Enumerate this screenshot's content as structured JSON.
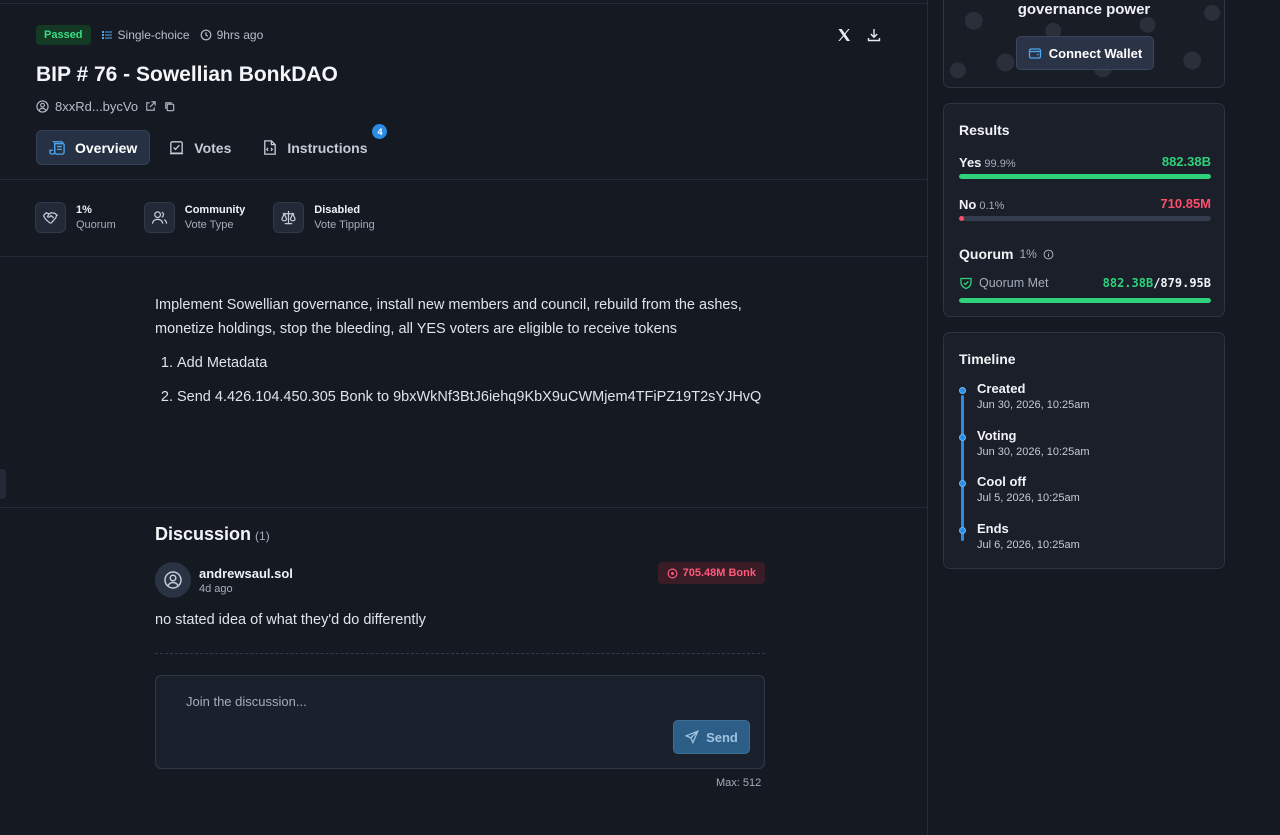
{
  "proposal": {
    "status": "Passed",
    "vote_mode": "Single-choice",
    "age": "9hrs ago",
    "title": "BIP # 76 - Sowellian BonkDAO",
    "author_address": "8xxRd...bycVo"
  },
  "tabs": [
    {
      "label": "Overview",
      "active": true
    },
    {
      "label": "Votes",
      "active": false
    },
    {
      "label": "Instructions",
      "active": false,
      "count": "4"
    }
  ],
  "stats": [
    {
      "value": "1%",
      "label": "Quorum",
      "icon": "handshake-icon"
    },
    {
      "value": "Community",
      "label": "Vote Type",
      "icon": "users-icon"
    },
    {
      "value": "Disabled",
      "label": "Vote Tipping",
      "icon": "scale-icon"
    }
  ],
  "description": {
    "text": "Implement Sowellian governance, install new members and council, rebuild from the ashes, monetize holdings, stop the bleeding, all YES voters are eligible to receive tokens",
    "steps": [
      "Add Metadata",
      "Send 4.426.104.450.305 Bonk to 9bxWkNf3BtJ6iehq9KbX9uCWMjem4TFiPZ19T2sYJHvQ"
    ]
  },
  "discussion": {
    "title": "Discussion",
    "count": "(1)",
    "comments": [
      {
        "author": "andrewsaul.sol",
        "time": "4d ago",
        "vote_badge": "705.48M Bonk",
        "body": "no stated idea of what they'd do differently"
      }
    ],
    "composer_placeholder": "Join the discussion...",
    "send_label": "Send",
    "max_label": "Max: 512"
  },
  "governance": {
    "title": "governance power",
    "connect_label": "Connect Wallet"
  },
  "results": {
    "title": "Results",
    "yes": {
      "label": "Yes",
      "pct": "99.9%",
      "value": "882.38B",
      "fraction": 0.999
    },
    "no": {
      "label": "No",
      "pct": "0.1%",
      "value": "710.85M",
      "fraction": 0.001
    },
    "quorum_label": "Quorum",
    "quorum_pct": "1%",
    "quorum_met_label": "Quorum Met",
    "quorum_have": "882.38B",
    "quorum_need": "/879.95B",
    "quorum_fraction": 1.0
  },
  "timeline": {
    "title": "Timeline",
    "items": [
      {
        "name": "Created",
        "date": "Jun 30, 2026, 10:25am"
      },
      {
        "name": "Voting",
        "date": "Jun 30, 2026, 10:25am"
      },
      {
        "name": "Cool off",
        "date": "Jul 5, 2026, 10:25am"
      },
      {
        "name": "Ends",
        "date": "Jul 6, 2026, 10:25am"
      }
    ]
  },
  "colors": {
    "yes": "#2fd17a",
    "no": "#ff4d6d",
    "accent": "#2a8ce2",
    "passed": "#3ddc84"
  }
}
